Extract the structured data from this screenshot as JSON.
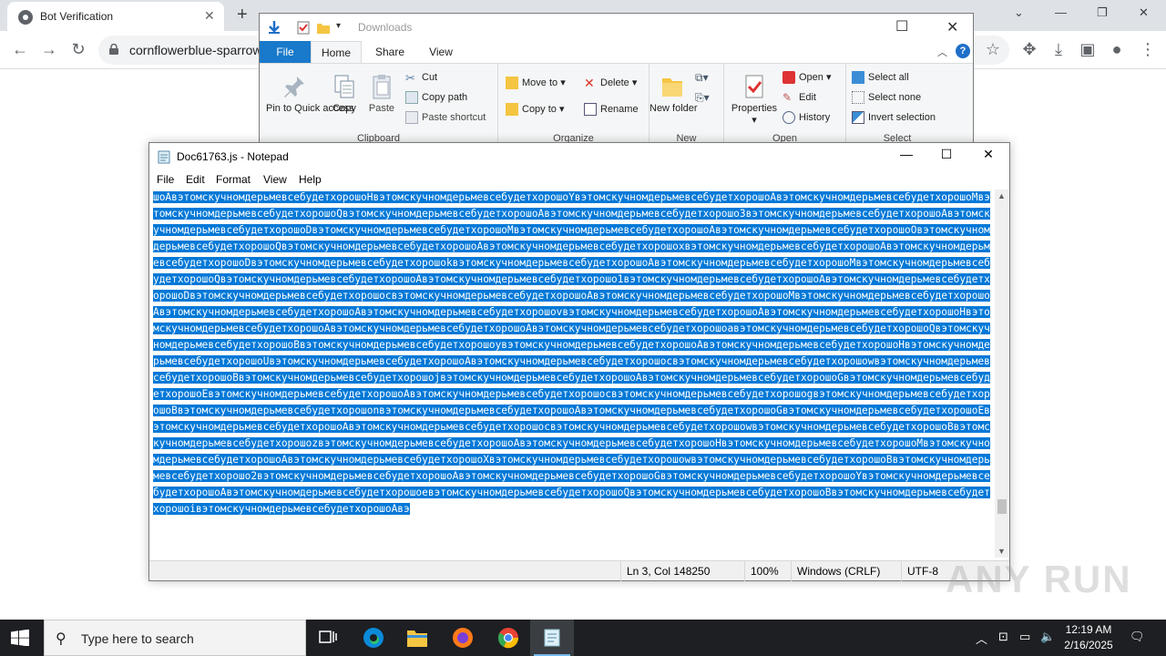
{
  "browser": {
    "tab_title": "Bot Verification",
    "tab_close": "✕",
    "new_tab": "+",
    "url": "cornflowerblue-sparrow",
    "win_minimize": "—",
    "win_restore": "❐",
    "win_close": "✕",
    "tab_search": "⌄"
  },
  "explorer": {
    "title": "Downloads",
    "tabs": [
      "File",
      "Home",
      "Share",
      "View"
    ],
    "clipboard": {
      "label": "Clipboard",
      "pin_label": "Pin to Quick access",
      "copy_label": "Copy",
      "paste_label": "Paste",
      "cut_label": "Cut",
      "copy_path_label": "Copy path",
      "paste_shortcut_label": "Paste shortcut"
    },
    "organize": {
      "label": "Organize",
      "move_to": "Move to",
      "copy_to": "Copy to",
      "delete": "Delete",
      "rename": "Rename"
    },
    "new": {
      "label": "New",
      "new_folder": "New folder"
    },
    "open": {
      "label": "Open",
      "properties": "Properties",
      "open": "Open",
      "edit": "Edit",
      "history": "History"
    },
    "select": {
      "label": "Select",
      "select_all": "Select all",
      "select_none": "Select none",
      "invert_selection": "Invert selection"
    }
  },
  "notepad": {
    "title": "Doc61763.js - Notepad",
    "menu": [
      "File",
      "Edit",
      "Format",
      "View",
      "Help"
    ],
    "content_line": "шоАвэтомскучномдерьмевсебудетхорошоНвэтомскучномдерьмевсебудетхорошоYвэтомскучномдерьмевсебудетхорошоАвэтомскучномдерьмевсебудетхорошоМвэтомскучномдерьмевсебудетхорошоQвэтомскучномдерьмевсебудетхорошоАвэтомскучномдерьмевсебудетхорошо3вэтомскучномдерьмевсебудетхорошоАвэтомскучномдерьмевсебудетхорошоDвэтомскучномдерьмевсебудетхорошоМвэтомскучномдерьмевсебудетхорошоАвэтомскучномдерьмевсебудетхорошоOвэтомскучномдерьмевсебудетхорошоQвэтомскучномдерьмевсебудетхорошоАвэтомскучномдерьмевсебудетхорошохвэтомскучномдерьмевсебудетхорошоАвэтомскучномдерьмевсебудетхорошоDвэтомскучномдерьмевсебудетхорошоkвэтомскучномдерьмевсебудетхорошоАвэтомскучномдерьмевсебудетхорошоМвэтомскучномдерьмевсебудетхорошоQвэтомскучномдерьмевсебудетхорошоАвэтомскучномдерьмевсебудетхорошо1вэтомскучномдерьмевсебудетхорошоАвэтомскучномдерьмевсебудетхорошоDвэтомскучномдерьмевсебудетхорошоcвэтомскучномдерьмевсебудетхорошоАвэтомскучномдерьмевсебудетхорошоМвэтомскучномдерьмевсебудетхорошоАвэтомскучномдерьмевсебудетхорошоАвэтомскучномдерьмевсебудетхорошоvвэтомскучномдерьмевсебудетхорошоАвэтомскучномдерьмевсебудетхорошоНвэтомскучномдерьмевсебудетхорошоАвэтомскучномдерьмевсебудетхорошоАвэтомскучномдерьмевсебудетхорошоaвэтомскучномдерьмевсебудетхорошоQвэтомскучномдерьмевсебудетхорошоВвэтомскучномдерьмевсебудетхорошоyвэтомскучномдерьмевсебудетхорошоАвэтомскучномдерьмевсебудетхорошоНвэтомскучномдерьмевсебудетхорошоUвэтомскучномдерьмевсебудетхорошоАвэтомскучномдерьмевсебудетхорошоcвэтомскучномдерьмевсебудетхорошоwвэтомскучномдерьмевсебудетхорошоВвэтомскучномдерьмевсебудетхорошоjвэтомскучномдерьмевсебудетхорошоАвэтомскучномдерьмевсебудетхорошоGвэтомскучномдерьмевсебудетхорошоEвэтомскучномдерьмевсебудетхорошоАвэтомскучномдерьмевсебудетхорошоcвэтомскучномдерьмевсебудетхорошоgвэтомскучномдерьмевсебудетхорошоВвэтомскучномдерьмевсебудетхорошоnвэтомскучномдерьмевсебудетхорошоАвэтомскучномдерьмевсебудетхорошоGвэтомскучномдерьмевсебудетхорошоEвэтомскучномдерьмевсебудетхорошоАвэтомскучномдерьмевсебудетхорошоcвэтомскучномдерьмевсебудетхорошоwвэтомскучномдерьмевсебудетхорошоВвэтомскучномдерьмевсебудетхорошоzвэтомскучномдерьмевсебудетхорошоАвэтомскучномдерьмевсебудетхорошоНвэтомскучномдерьмевсебудетхорошоМвэтомскучномдерьмевсебудетхорошоАвэтомскучномдерьмевсебудетхорошоXвэтомскучномдерьмевсебудетхорошоwвэтомскучномдерьмевсебудетхорошоВвэтомскучномдерьмевсебудетхорошо2вэтомскучномдерьмевсебудетхорошоАвэтомскучномдерьмевсебудетхорошоGвэтомскучномдерьмевсебудетхорошоYвэтомскучномдерьмевсебудетхорошоАвэтомскучномдерьмевсебудетхорошоeвэтомскучномдерьмевсебудетхорошоQвэтомскучномдерьмевсебудетхорошоВвэтомскучномдерьмевсебудетхорошоiвэтомскучномдерьмевсебудетхорошоАвэ",
    "status": {
      "position": "Ln 3, Col 148250",
      "zoom": "100%",
      "line_endings": "Windows (CRLF)",
      "encoding": "UTF-8"
    }
  },
  "watermark": "ANY RUN",
  "taskbar": {
    "search_placeholder": "Type here to search",
    "time": "12:19 AM",
    "date": "2/16/2025"
  },
  "colors": {
    "selection": "#0078d7",
    "explorer_file_tab": "#1979ca",
    "taskbar": "#1d1f23"
  }
}
